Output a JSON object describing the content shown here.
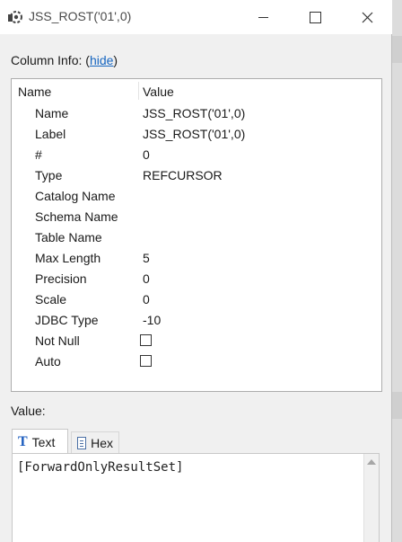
{
  "window": {
    "title": "JSS_ROST('01',0)",
    "icon": "gear-icon"
  },
  "column_info": {
    "label": "Column Info: (",
    "hide_link": "hide",
    "label_end": ")"
  },
  "table": {
    "header_name": "Name",
    "header_value": "Value",
    "rows": [
      {
        "name": "Name",
        "value": "JSS_ROST('01',0)"
      },
      {
        "name": "Label",
        "value": "JSS_ROST('01',0)"
      },
      {
        "name": "#",
        "value": "0"
      },
      {
        "name": "Type",
        "value": "REFCURSOR"
      },
      {
        "name": "Catalog Name",
        "value": ""
      },
      {
        "name": "Schema Name",
        "value": ""
      },
      {
        "name": "Table Name",
        "value": ""
      },
      {
        "name": "Max Length",
        "value": "5"
      },
      {
        "name": "Precision",
        "value": "0"
      },
      {
        "name": "Scale",
        "value": "0"
      },
      {
        "name": "JDBC Type",
        "value": "-10"
      },
      {
        "name": "Not Null",
        "checked": false
      },
      {
        "name": "Auto",
        "checked": false
      }
    ]
  },
  "value_section": {
    "label": "Value:",
    "tabs": [
      {
        "label": "Text",
        "icon": "text-type-icon",
        "active": true
      },
      {
        "label": "Hex",
        "icon": "hex-grid-icon",
        "active": false
      }
    ],
    "content": "[ForwardOnlyResultSet]"
  }
}
